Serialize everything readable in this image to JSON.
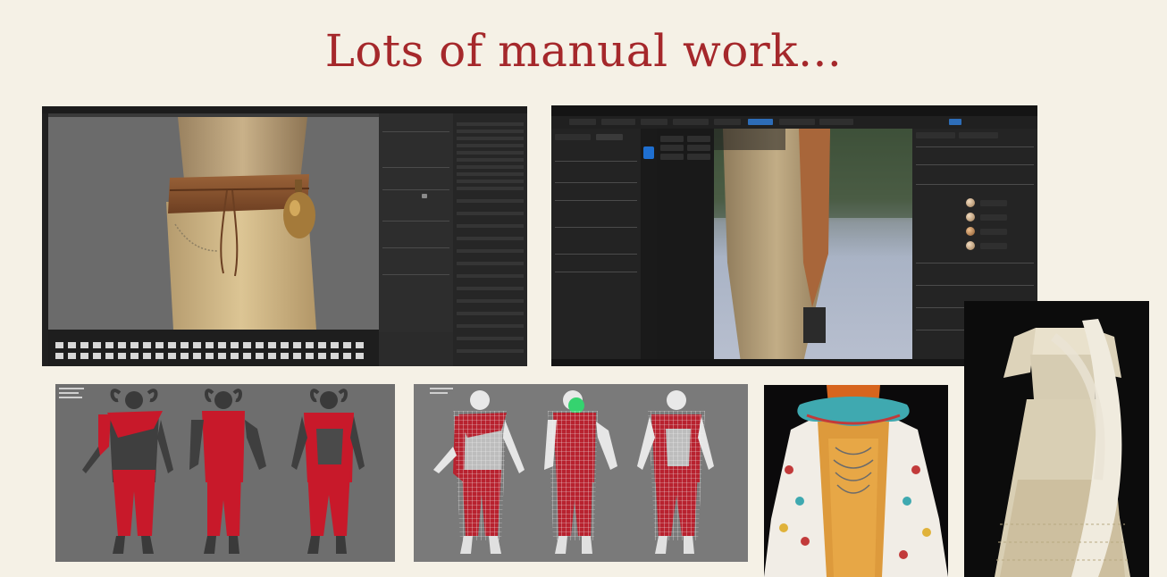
{
  "slide": {
    "title": "Lots of manual work..."
  },
  "panels": [
    {
      "name": "texturing-software-screenshot"
    },
    {
      "name": "game-engine-clothing-editor-screenshot"
    },
    {
      "name": "red-costume-sculpt-turnaround"
    },
    {
      "name": "wireframe-costume-turnaround"
    },
    {
      "name": "clown-costume-render"
    },
    {
      "name": "saree-garment-render"
    }
  ],
  "colors": {
    "title": "#a5282b",
    "background": "#f5f1e6",
    "costume_red": "#c8192a",
    "engine_accent": "#1f6fd0"
  }
}
